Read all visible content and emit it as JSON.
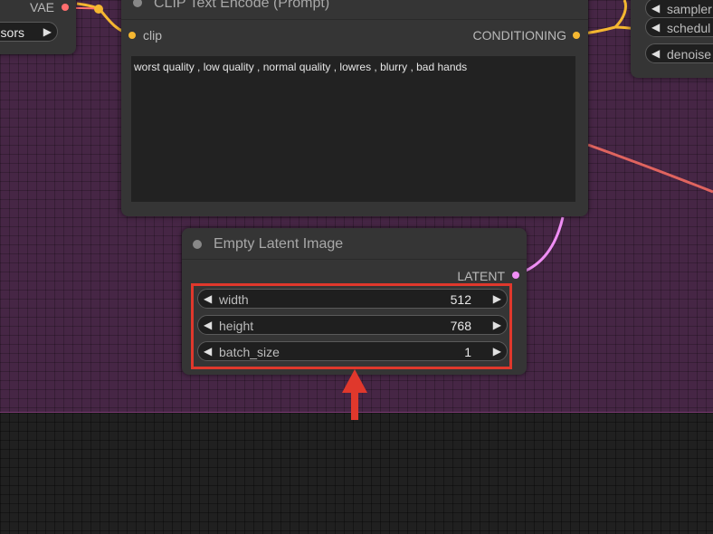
{
  "nodes": {
    "vae_loader": {
      "output_label": "VAE",
      "widget_value": "sors"
    },
    "clip_text_encode": {
      "title": "CLIP Text Encode (Prompt)",
      "input_label": "clip",
      "output_label": "CONDITIONING",
      "prompt_text": "worst quality , low quality , normal quality , lowres , blurry , bad hands"
    },
    "ksampler": {
      "widgets": [
        {
          "label": "sampler"
        },
        {
          "label": "schedul"
        },
        {
          "label": "denoise"
        }
      ]
    },
    "empty_latent": {
      "title": "Empty Latent Image",
      "output_label": "LATENT",
      "widgets": [
        {
          "label": "width",
          "value": "512"
        },
        {
          "label": "height",
          "value": "768"
        },
        {
          "label": "batch_size",
          "value": "1"
        }
      ]
    }
  },
  "colors": {
    "canvas": "#462645",
    "node": "#353535",
    "highlight": "#e0382c",
    "clip_slot": "#f5b731",
    "latent_slot": "#f08ef5",
    "vae_slot": "#ff6e6e"
  },
  "icons": {
    "decrement": "◀",
    "increment": "▶",
    "pointer": "up-arrow-icon"
  }
}
